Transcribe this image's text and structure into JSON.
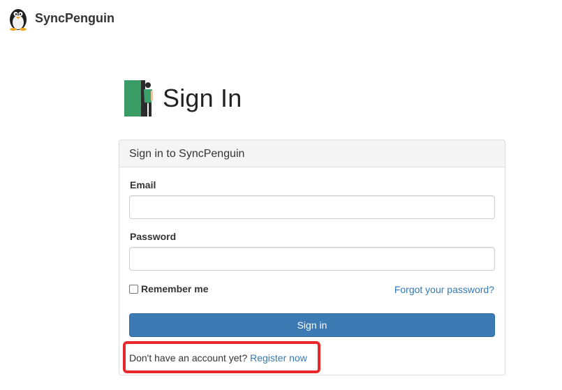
{
  "brand": {
    "name": "SyncPenguin",
    "logo_icon": "penguin-icon"
  },
  "page": {
    "title": "Sign In",
    "illustration_icon": "door-person-icon"
  },
  "panel": {
    "heading": "Sign in to SyncPenguin",
    "email": {
      "label": "Email",
      "value": "",
      "placeholder": ""
    },
    "password": {
      "label": "Password",
      "value": "",
      "placeholder": ""
    },
    "remember_label": "Remember me",
    "remember_checked": false,
    "forgot_label": "Forgot your password?",
    "submit_label": "Sign in",
    "register_prompt": "Don't have an account yet?",
    "register_link": "Register now"
  },
  "colors": {
    "primary": "#3c7ab4",
    "link": "#337ab7",
    "highlight": "#e8282b",
    "door_green": "#3a9b64"
  }
}
